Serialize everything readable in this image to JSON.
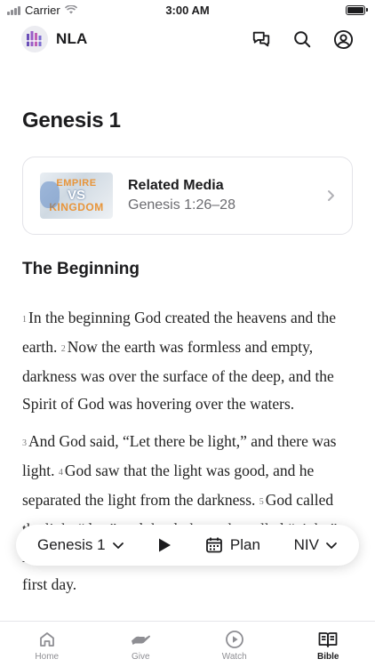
{
  "status_bar": {
    "carrier": "Carrier",
    "time": "3:00 AM"
  },
  "header": {
    "app_name": "NLA"
  },
  "chapter": {
    "title": "Genesis 1"
  },
  "related_media": {
    "title": "Related Media",
    "reference": "Genesis 1:26–28",
    "thumbnail_text": [
      "EMPIRE",
      "VS",
      "KINGDOM"
    ]
  },
  "section": {
    "heading": "The Beginning"
  },
  "passage": {
    "paragraphs": [
      {
        "verses": [
          {
            "num": "1",
            "text": "In the beginning God created the heavens and the earth."
          },
          {
            "num": "2",
            "text": "Now the earth was formless and empty, darkness was over the surface of the deep, and the Spirit of God was hovering over the waters."
          }
        ]
      },
      {
        "verses": [
          {
            "num": "3",
            "text": "And God said, “Let there be light,” and there was light."
          },
          {
            "num": "4",
            "text": "God saw that the light was good, and he separated the light from the darkness."
          },
          {
            "num": "5",
            "text": "God called the light “day,” and the darkness he called “night.” And there was evening, and there was morning—the first day."
          }
        ]
      }
    ]
  },
  "reader_bar": {
    "chapter": "Genesis 1",
    "plan_label": "Plan",
    "version": "NIV"
  },
  "tabs": [
    {
      "label": "Home",
      "icon": "home-icon",
      "active": false
    },
    {
      "label": "Give",
      "icon": "give-icon",
      "active": false
    },
    {
      "label": "Watch",
      "icon": "watch-icon",
      "active": false
    },
    {
      "label": "Bible",
      "icon": "bible-icon",
      "active": true
    }
  ],
  "colors": {
    "text": "#1c1c1e",
    "muted": "#8e8e93",
    "card_border": "#e3e3e8"
  }
}
